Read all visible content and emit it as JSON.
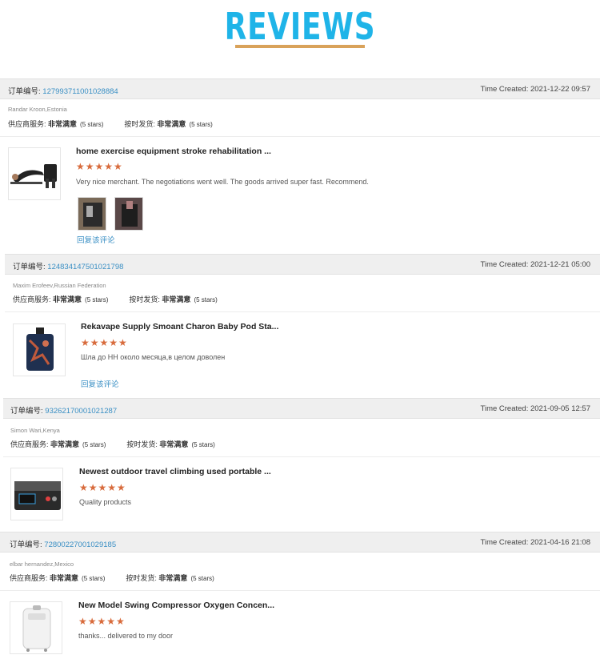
{
  "header": {
    "title": "REVIEWS"
  },
  "reviews": [
    {
      "order_label": "订单编号:",
      "order_number": "127993711001028884",
      "time": "Time Created: 2021-12-22 09:57",
      "buyer": "Randar Kroon,Estonia",
      "supplier_label": "供应商服务:",
      "supplier_value": "非常满意",
      "supplier_stars": "(5 stars)",
      "delivery_label": "按时发货:",
      "delivery_value": "非常满意",
      "delivery_stars": "(5 stars)",
      "product": "home exercise equipment stroke rehabilitation ...",
      "rating": "★★★★★",
      "comment": "Very nice merchant. The negotiations went well. The goods arrived super fast. Recommend.",
      "reply": "回复该评论"
    },
    {
      "order_label": "订单编号:",
      "order_number": "124834147501021798",
      "time": "Time Created: 2021-12-21 05:00",
      "buyer": "Maxim Erofeev,Russian Federation",
      "supplier_label": "供应商服务:",
      "supplier_value": "非常满意",
      "supplier_stars": "(5 stars)",
      "delivery_label": "按时发货:",
      "delivery_value": "非常满意",
      "delivery_stars": "(5 stars)",
      "product": "Rekavape Supply Smoant Charon Baby Pod Sta...",
      "rating": "★★★★★",
      "comment": "Шла до НН около месяца,в целом доволен",
      "reply": "回复该评论"
    },
    {
      "order_label": "订单编号:",
      "order_number": "93262170001021287",
      "time": "Time Created: 2021-09-05 12:57",
      "buyer": "Simon Wari,Kenya",
      "supplier_label": "供应商服务:",
      "supplier_value": "非常满意",
      "supplier_stars": "(5 stars)",
      "delivery_label": "按时发货:",
      "delivery_value": "非常满意",
      "delivery_stars": "(5 stars)",
      "product": "Newest outdoor travel climbing used portable ...",
      "rating": "★★★★★",
      "comment": "Quality products"
    },
    {
      "order_label": "订单编号:",
      "order_number": "72800227001029185",
      "time": "Time Created: 2021-04-16 21:08",
      "buyer": "elbar hernandez,Mexico",
      "supplier_label": "供应商服务:",
      "supplier_value": "非常满意",
      "supplier_stars": "(5 stars)",
      "delivery_label": "按时发货:",
      "delivery_value": "非常满意",
      "delivery_stars": "(5 stars)",
      "product": "New Model Swing Compressor Oxygen Concen...",
      "rating": "★★★★★",
      "comment": "thanks... delivered to my door"
    }
  ],
  "colors": {
    "accent": "#1fb4e8",
    "link": "#3a8fc4",
    "star": "#d86b3c",
    "bar": "#efefef"
  }
}
